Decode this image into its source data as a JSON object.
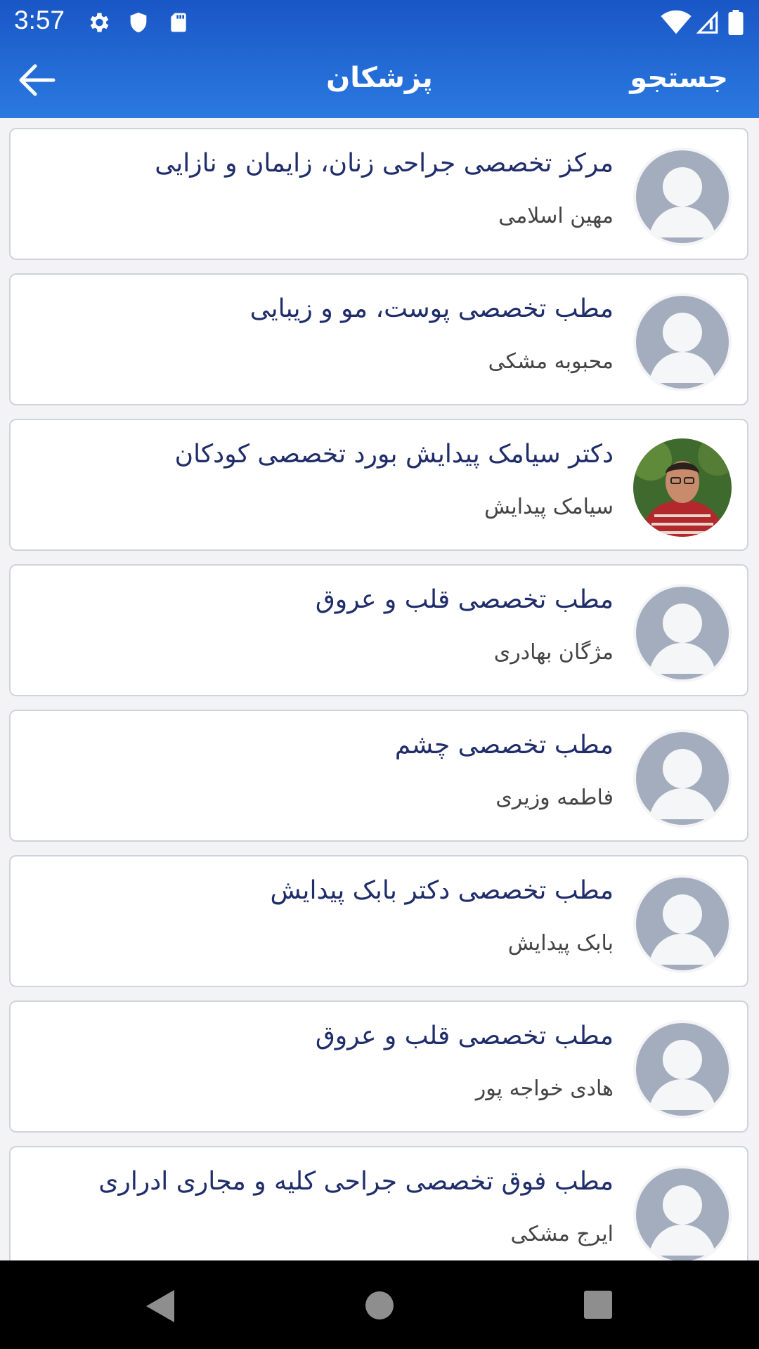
{
  "status_bar": {
    "time": "3:57"
  },
  "toolbar": {
    "title": "پزشکان",
    "search_label": "جستجو"
  },
  "doctors": [
    {
      "clinic": "مرکز تخصصی جراحی زنان، زایمان و نازایی",
      "name": "مهین اسلامی",
      "photo": "placeholder"
    },
    {
      "clinic": "مطب تخصصی پوست، مو و زیبایی",
      "name": "محبوبه مشکی",
      "photo": "placeholder"
    },
    {
      "clinic": "دکتر سیامک پیدایش بورد تخصصی کودکان",
      "name": "سیامک پیدایش",
      "photo": "portrait"
    },
    {
      "clinic": "مطب تخصصی قلب و عروق",
      "name": "مژگان بهادری",
      "photo": "placeholder"
    },
    {
      "clinic": "مطب تخصصی چشم",
      "name": "فاطمه وزیری",
      "photo": "placeholder"
    },
    {
      "clinic": "مطب تخصصی دکتر بابک پیدایش",
      "name": "بابک پیدایش",
      "photo": "placeholder"
    },
    {
      "clinic": "مطب تخصصی قلب و عروق",
      "name": "هادی خواجه پور",
      "photo": "placeholder"
    },
    {
      "clinic": "مطب فوق تخصصی جراحی کلیه و مجاری ادراری",
      "name": "ایرج مشکی",
      "photo": "placeholder"
    }
  ],
  "colors": {
    "appbar": "#1a56c6",
    "clinic_text": "#1f2d6b",
    "avatar_placeholder": "#a4adbd"
  }
}
